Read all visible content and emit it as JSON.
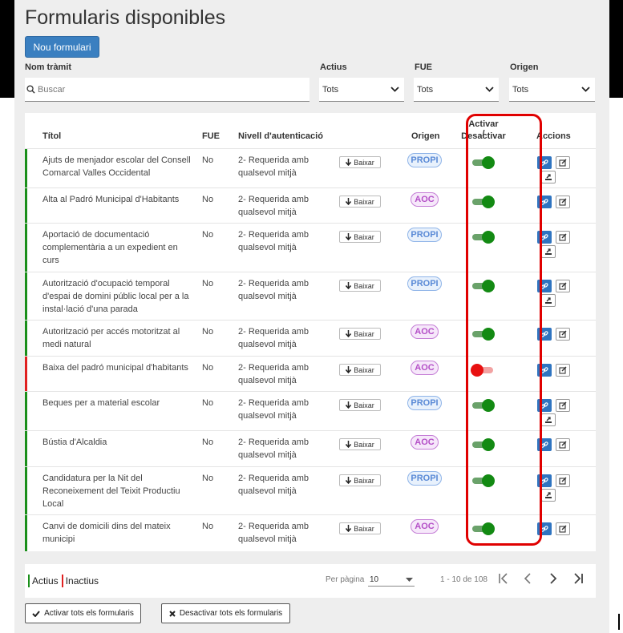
{
  "page": {
    "title": "Formularis disponibles",
    "new_button": "Nou formulari"
  },
  "filters": {
    "name_label": "Nom tràmit",
    "search_placeholder": "Buscar",
    "actius": {
      "label": "Actius",
      "value": "Tots"
    },
    "fue": {
      "label": "FUE",
      "value": "Tots"
    },
    "origen": {
      "label": "Origen",
      "value": "Tots"
    }
  },
  "table": {
    "headers": {
      "titol": "Títol",
      "fue": "FUE",
      "nivell": "Nivell d'autenticació",
      "origen": "Origen",
      "activar_1": "Activar /",
      "activar_2": "Desactivar",
      "accions": "Accions"
    },
    "download_label": "Baixar",
    "rows": [
      {
        "title": "Ajuts de menjador escolar del Consell Comarcal Valles Occidental",
        "fue": "No",
        "nivell": "2- Requerida amb qualsevol mitjà",
        "origen": "PROPI",
        "active": true,
        "status_color": "#1a8f1a"
      },
      {
        "title": "Alta al Padró Municipal d'Habitants",
        "fue": "No",
        "nivell": "2- Requerida amb qualsevol mitjà",
        "origen": "AOC",
        "active": true,
        "status_color": "#1a8f1a"
      },
      {
        "title": "Aportació de documentació complementària a un expedient en curs",
        "fue": "No",
        "nivell": "2- Requerida amb qualsevol mitjà",
        "origen": "PROPI",
        "active": true,
        "status_color": "#1a8f1a"
      },
      {
        "title": "Autorització d'ocupació temporal d'espai de domini públic local per a la instal·lació d'una parada",
        "fue": "No",
        "nivell": "2- Requerida amb qualsevol mitjà",
        "origen": "PROPI",
        "active": true,
        "status_color": "#1a8f1a"
      },
      {
        "title": "Autorització per accés motoritzat al medi natural",
        "fue": "No",
        "nivell": "2- Requerida amb qualsevol mitjà",
        "origen": "AOC",
        "active": true,
        "status_color": "#1a8f1a"
      },
      {
        "title": "Baixa del padró municipal d'habitants",
        "fue": "No",
        "nivell": "2- Requerida amb qualsevol mitjà",
        "origen": "AOC",
        "active": false,
        "status_color": "#e02020"
      },
      {
        "title": "Beques per a material escolar",
        "fue": "No",
        "nivell": "2- Requerida amb qualsevol mitjà",
        "origen": "PROPI",
        "active": true,
        "status_color": "#1a8f1a"
      },
      {
        "title": "Bústia d'Alcaldia",
        "fue": "No",
        "nivell": "2- Requerida amb qualsevol mitjà",
        "origen": "AOC",
        "active": true,
        "status_color": "#1a8f1a"
      },
      {
        "title": "Candidatura per la Nit del Reconeixement del Teixit Productiu Local",
        "fue": "No",
        "nivell": "2- Requerida amb qualsevol mitjà",
        "origen": "PROPI",
        "active": true,
        "status_color": "#1a8f1a"
      },
      {
        "title": "Canvi de domicili dins del mateix municipi",
        "fue": "No",
        "nivell": "2- Requerida amb qualsevol mitjà",
        "origen": "AOC",
        "active": true,
        "status_color": "#1a8f1a"
      }
    ]
  },
  "footer": {
    "legend_active": "Actius",
    "legend_inactive": "Inactius",
    "per_page_label": "Per pàgina",
    "per_page_value": "10",
    "range": "1 - 10 de 108",
    "activate_all": "Activar tots els formularis",
    "deactivate_all": "Desactivar tots els formularis"
  }
}
